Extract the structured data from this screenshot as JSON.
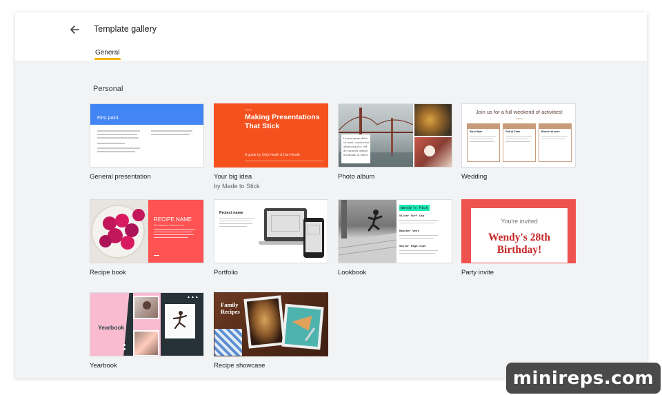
{
  "header": {
    "title": "Template gallery",
    "back_icon": "arrow-left-icon",
    "tabs": [
      {
        "label": "General",
        "active": true
      }
    ]
  },
  "section": {
    "label": "Personal"
  },
  "accent_color": "#f4b400",
  "templates": [
    {
      "name": "General presentation",
      "thumb_heading": "First point",
      "color": "#4285f4"
    },
    {
      "name": "Your big idea",
      "subtitle": "by Made to Stick",
      "thumb_heading": "Making Presentations That Stick",
      "thumb_caption": "A guide by Chip Heath & Dan Heath",
      "color": "#f4511e"
    },
    {
      "name": "Photo album",
      "thumb_text": "Lorem ipsum dolor sit amet, consectetur adipiscing elit, sed do eiusmod tempor incididunt ut labore"
    },
    {
      "name": "Wedding",
      "thumb_heading": "Join us for a full weekend of activities!",
      "thumb_columns": [
        "Friday",
        "Saturday",
        "Sunday"
      ],
      "thumb_events": [
        "Sip at 9pm",
        "Golf at 11am",
        "Brunch at noon"
      ],
      "color": "#c89b7b"
    },
    {
      "name": "Recipe book",
      "thumb_heading": "RECIPE NAME",
      "thumb_caption": "30 minutes • Serves 4–6",
      "color": "#ff5252"
    },
    {
      "name": "Portfolio",
      "thumb_heading": "Project name"
    },
    {
      "name": "Lookbook",
      "thumb_heading": "Wendy's Pick",
      "thumb_items": [
        "Siloer Surf Cap",
        "Rancher Vest",
        "Sailor High-Tops"
      ],
      "color": "#1de9b6"
    },
    {
      "name": "Party invite",
      "thumb_heading": "You're invited",
      "thumb_title": "Wendy's 28th Birthday!",
      "color": "#ef5350"
    },
    {
      "name": "Yearbook",
      "thumb_heading": "Yearbook",
      "color": "#f8bbd0"
    },
    {
      "name": "Recipe showcase",
      "thumb_heading": "Family Recipes"
    }
  ],
  "watermark": "minireps.com"
}
